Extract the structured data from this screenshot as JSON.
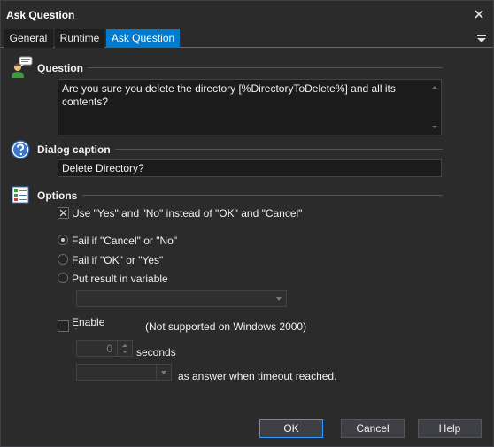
{
  "window": {
    "title": "Ask Question"
  },
  "tabs": [
    {
      "label": "General",
      "active": false
    },
    {
      "label": "Runtime",
      "active": false
    },
    {
      "label": "Ask Question",
      "active": true
    }
  ],
  "question": {
    "heading": "Question",
    "text": "Are you sure you delete the directory [%DirectoryToDelete%] and all its contents?"
  },
  "caption": {
    "heading": "Dialog caption",
    "value": "Delete Directory?"
  },
  "options": {
    "heading": "Options",
    "use_yes_no": {
      "label": "Use \"Yes\" and \"No\" instead of \"OK\" and \"Cancel\"",
      "checked": true
    },
    "radios": [
      {
        "label": "Fail if \"Cancel\" or \"No\"",
        "selected": true
      },
      {
        "label": "Fail if \"OK\" or \"Yes\"",
        "selected": false
      },
      {
        "label": "Put result in variable",
        "selected": false
      }
    ],
    "variable_select": {
      "value": ""
    },
    "enable_timeout": {
      "label": "Enable timeout",
      "checked": false
    },
    "timeout_note": "(Not supported on Windows 2000)",
    "timeout_seconds": {
      "value": "0",
      "unit_label": "seconds"
    },
    "timeout_answer": {
      "value": "",
      "suffix_label": "as answer when timeout reached."
    }
  },
  "buttons": {
    "ok": "OK",
    "cancel": "Cancel",
    "help": "Help"
  },
  "colors": {
    "accent": "#007acc",
    "background": "#2b2b2b",
    "field": "#1b1b1c",
    "default_button_border": "#3399ff"
  }
}
